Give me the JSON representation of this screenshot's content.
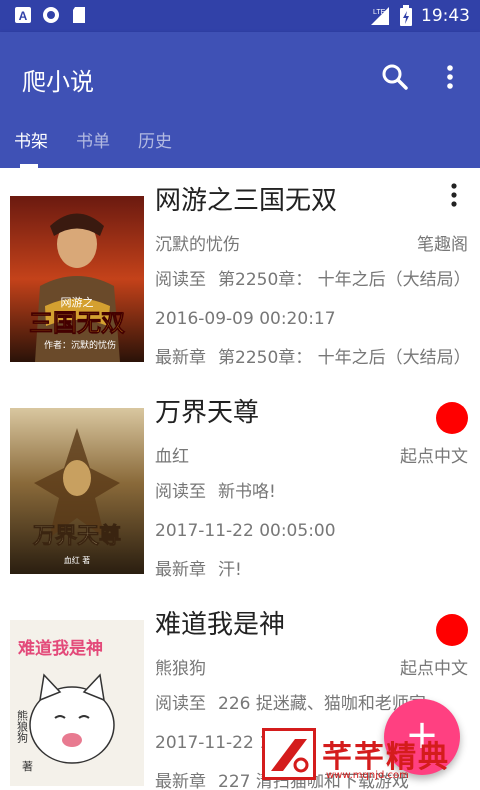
{
  "status_bar": {
    "time": "19:43",
    "network_label": "LTE"
  },
  "app_bar": {
    "title": "爬小说",
    "tabs": [
      {
        "label": "书架",
        "active": true
      },
      {
        "label": "书单",
        "active": false
      },
      {
        "label": "历史",
        "active": false
      }
    ]
  },
  "books": [
    {
      "title": "网游之三国无双",
      "author": "沉默的忧伤",
      "source": "笔趣阁",
      "read_label": "阅读至",
      "read_chapter": "第2250章：  十年之后（大结局）",
      "time": "2016-09-09 00:20:17",
      "latest_label": "最新章",
      "latest_chapter": "第2250章：  十年之后（大结局）",
      "has_update": false,
      "cover": {
        "line1": "网游之",
        "line2": "三国无双",
        "line3": "作者：沉默的忧伤"
      }
    },
    {
      "title": "万界天尊",
      "author": "血红",
      "source": "起点中文",
      "read_label": "阅读至",
      "read_chapter": "新书咯!",
      "time": "2017-11-22 00:05:00",
      "latest_label": "最新章",
      "latest_chapter": "汗!",
      "has_update": true,
      "cover": {
        "line1": "万界天尊",
        "line2": "",
        "line3": "血红 著"
      }
    },
    {
      "title": "难道我是神",
      "author": "熊狼狗",
      "source": "起点中文",
      "read_label": "阅读至",
      "read_chapter": "226 捉迷藏、猫咖和老师家",
      "time": "2017-11-22 1",
      "latest_label": "最新章",
      "latest_chapter": "227 清扫猫咖和下载游戏",
      "has_update": true,
      "cover": {
        "line1": "难道我是神",
        "line2": "熊狼狗",
        "line3": "著"
      }
    }
  ],
  "fab": {
    "label": "+"
  },
  "watermark": {
    "text": "芊芊精典",
    "url": "www.mqnjd.com"
  },
  "colors": {
    "primary": "#3f51b5",
    "primary_dark": "#3141a8",
    "accent": "#ff4081",
    "badge": "#ff0000"
  }
}
